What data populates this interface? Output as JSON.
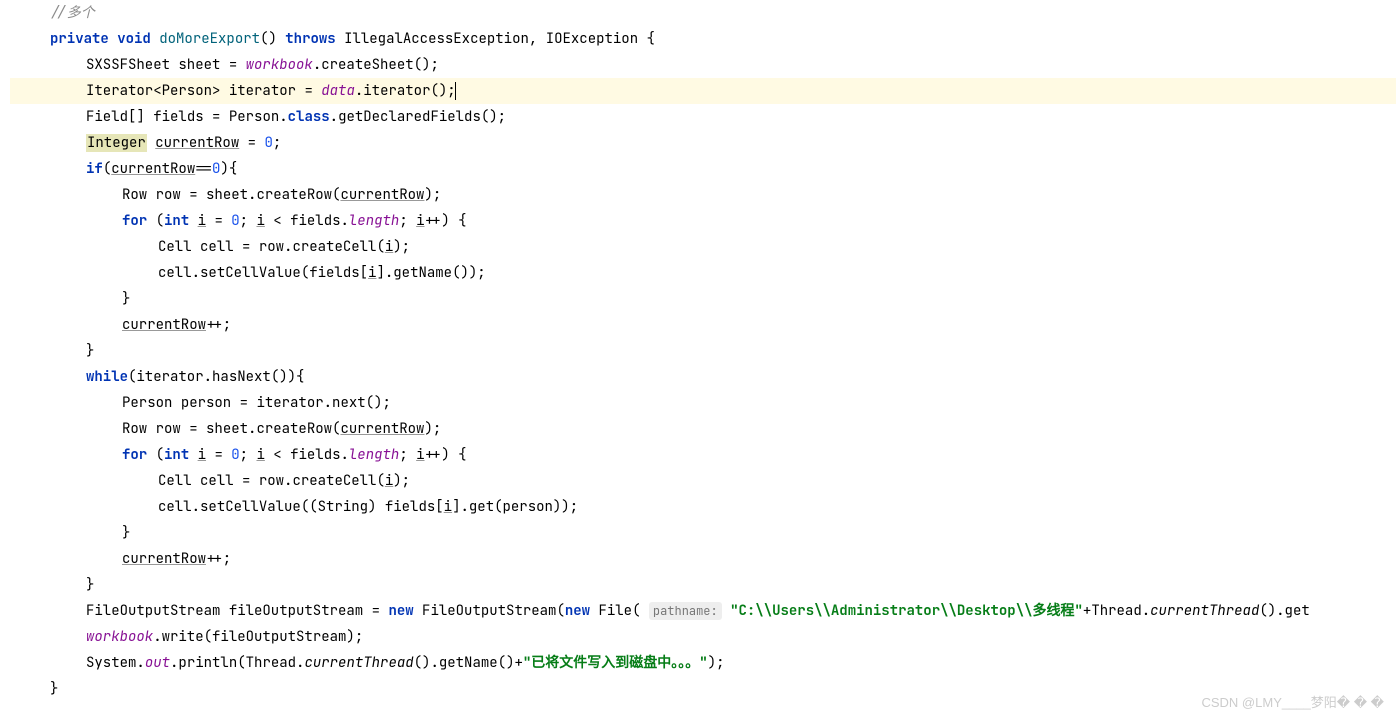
{
  "code": {
    "comment": "//多个",
    "l1": {
      "private": "private",
      "void": "void",
      "method": "doMoreExport",
      "throws": "throws",
      "ex1": "IllegalAccessException",
      "ex2": "IOException"
    },
    "l2": {
      "type": "SXSSFSheet",
      "var": "sheet",
      "field": "workbook",
      "call": "createSheet"
    },
    "l3": {
      "type1": "Iterator",
      "gen": "Person",
      "var": "iterator",
      "field": "data",
      "call": "iterator"
    },
    "l4": {
      "type1": "Field",
      "var": "fields",
      "cls": "Person",
      "classKw": "class",
      "call": "getDeclaredFields"
    },
    "l5": {
      "type": "Integer",
      "var": "currentRow",
      "val": "0"
    },
    "l6": {
      "if": "if",
      "var": "currentRow",
      "val": "0"
    },
    "l7": {
      "type": "Row",
      "var": "row",
      "obj": "sheet",
      "call": "createRow",
      "arg": "currentRow"
    },
    "l8": {
      "for": "for",
      "int": "int",
      "i": "i",
      "zero": "0",
      "fields": "fields",
      "length": "length"
    },
    "l9": {
      "type": "Cell",
      "var": "cell",
      "row": "row",
      "call": "createCell",
      "arg": "i"
    },
    "l10": {
      "cell": "cell",
      "set": "setCellValue",
      "fields": "fields",
      "i": "i",
      "get": "getName"
    },
    "l12": {
      "var": "currentRow"
    },
    "l14": {
      "while": "while",
      "it": "iterator",
      "has": "hasNext"
    },
    "l15": {
      "type": "Person",
      "var": "person",
      "it": "iterator",
      "next": "next"
    },
    "l16": {
      "type": "Row",
      "var": "row",
      "sheet": "sheet",
      "call": "createRow",
      "arg": "currentRow"
    },
    "l17": {
      "for": "for",
      "int": "int",
      "i": "i",
      "zero": "0",
      "fields": "fields",
      "length": "length"
    },
    "l18": {
      "type": "Cell",
      "var": "cell",
      "row": "row",
      "call": "createCell",
      "arg": "i"
    },
    "l19": {
      "cell": "cell",
      "set": "setCellValue",
      "cast": "String",
      "fields": "fields",
      "i": "i",
      "get": "get",
      "person": "person"
    },
    "l21": {
      "var": "currentRow"
    },
    "l23": {
      "type": "FileOutputStream",
      "var": "fileOutputStream",
      "new": "new",
      "file": "File",
      "hint": "pathname:",
      "str1": "\"C:\\\\Users\\\\Administrator\\\\Desktop\\\\",
      "str2": "多线程\"",
      "thread": "Thread",
      "ct": "currentThread",
      "get": "get"
    },
    "l24": {
      "wb": "workbook",
      "write": "write",
      "arg": "fileOutputStream"
    },
    "l25": {
      "sys": "System",
      "out": "out",
      "println": "println",
      "thread": "Thread",
      "ct": "currentThread",
      "gn": "getName",
      "str": "\"已将文件写入到磁盘中。。。\""
    }
  },
  "watermark": "CSDN @LMY____梦阳� � �"
}
